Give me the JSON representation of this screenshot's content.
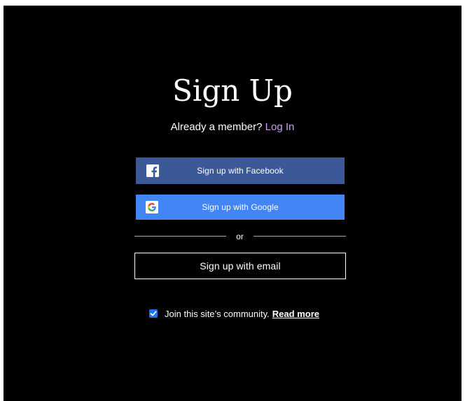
{
  "page": {
    "title": "Sign Up",
    "member_prompt": "Already a member?",
    "login_link": "Log In"
  },
  "buttons": {
    "facebook": {
      "label": "Sign up with Facebook",
      "icon": "facebook-icon",
      "color": "#3b5998"
    },
    "google": {
      "label": "Sign up with Google",
      "icon": "google-icon",
      "color": "#4285f4"
    },
    "email": {
      "label": "Sign up with email"
    }
  },
  "divider": {
    "text": "or"
  },
  "community": {
    "checked": true,
    "label": "Join this site’s community.",
    "read_more": "Read more"
  },
  "colors": {
    "background": "#000000",
    "link": "#c9a0e6",
    "checkbox": "#1a73e8"
  }
}
